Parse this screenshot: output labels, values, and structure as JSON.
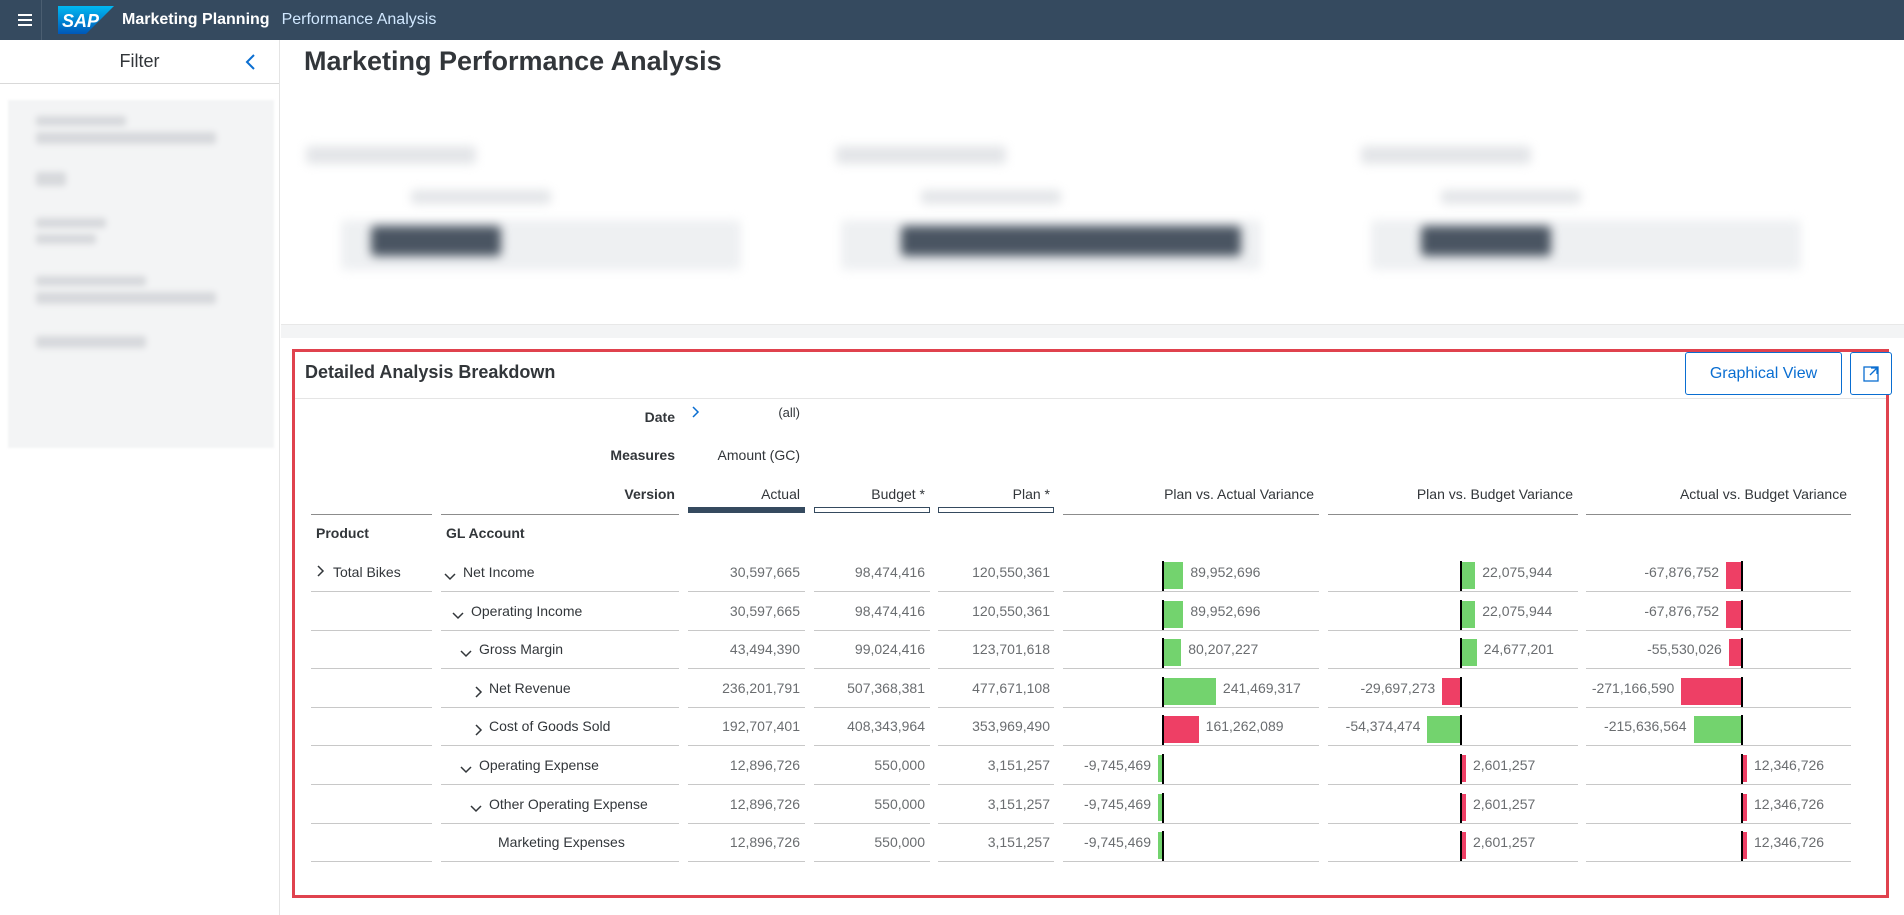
{
  "shell": {
    "logo_text": "SAP",
    "app_title": "Marketing Planning",
    "app_subtitle": "Performance Analysis"
  },
  "filter": {
    "title": "Filter"
  },
  "page": {
    "title": "Marketing Performance Analysis"
  },
  "panel": {
    "title": "Detailed Analysis Breakdown",
    "graphical_view_label": "Graphical View"
  },
  "table": {
    "date_label": "Date",
    "date_value": "(all)",
    "measures_label": "Measures",
    "measures_value": "Amount (GC)",
    "version_label": "Version",
    "product_header": "Product",
    "gl_header": "GL Account",
    "columns": [
      "Actual",
      "Budget *",
      "Plan *",
      "Plan vs. Actual Variance",
      "Plan vs. Budget Variance",
      "Actual vs. Budget Variance"
    ],
    "product_value": "Total Bikes",
    "rows": [
      {
        "account": "Net Income",
        "actual": "30,597,665",
        "budget": "98,474,416",
        "plan": "120,550,361",
        "pva": "89,952,696",
        "pvb": "22,075,944",
        "avb": "-67,876,752"
      },
      {
        "account": "Operating Income",
        "actual": "30,597,665",
        "budget": "98,474,416",
        "plan": "120,550,361",
        "pva": "89,952,696",
        "pvb": "22,075,944",
        "avb": "-67,876,752"
      },
      {
        "account": "Gross Margin",
        "actual": "43,494,390",
        "budget": "99,024,416",
        "plan": "123,701,618",
        "pva": "80,207,227",
        "pvb": "24,677,201",
        "avb": "-55,530,026"
      },
      {
        "account": "Net Revenue",
        "actual": "236,201,791",
        "budget": "507,368,381",
        "plan": "477,671,108",
        "pva": "241,469,317",
        "pvb": "-29,697,273",
        "avb": "-271,166,590"
      },
      {
        "account": "Cost of Goods Sold",
        "actual": "192,707,401",
        "budget": "408,343,964",
        "plan": "353,969,490",
        "pva": "161,262,089",
        "pvb": "-54,374,474",
        "avb": "-215,636,564"
      },
      {
        "account": "Operating Expense",
        "actual": "12,896,726",
        "budget": "550,000",
        "plan": "3,151,257",
        "pva": "-9,745,469",
        "pvb": "2,601,257",
        "avb": "12,346,726"
      },
      {
        "account": "Other Operating Expense",
        "actual": "12,896,726",
        "budget": "550,000",
        "plan": "3,151,257",
        "pva": "-9,745,469",
        "pvb": "2,601,257",
        "avb": "12,346,726"
      },
      {
        "account": "Marketing Expenses",
        "actual": "12,896,726",
        "budget": "550,000",
        "plan": "3,151,257",
        "pva": "-9,745,469",
        "pvb": "2,601,257",
        "avb": "12,346,726"
      }
    ]
  },
  "colors": {
    "shell": "#354a5f",
    "accent": "#0a6ed1",
    "positive": "#73d36e",
    "negative": "#ee3f65",
    "highlight": "#e0424e"
  }
}
